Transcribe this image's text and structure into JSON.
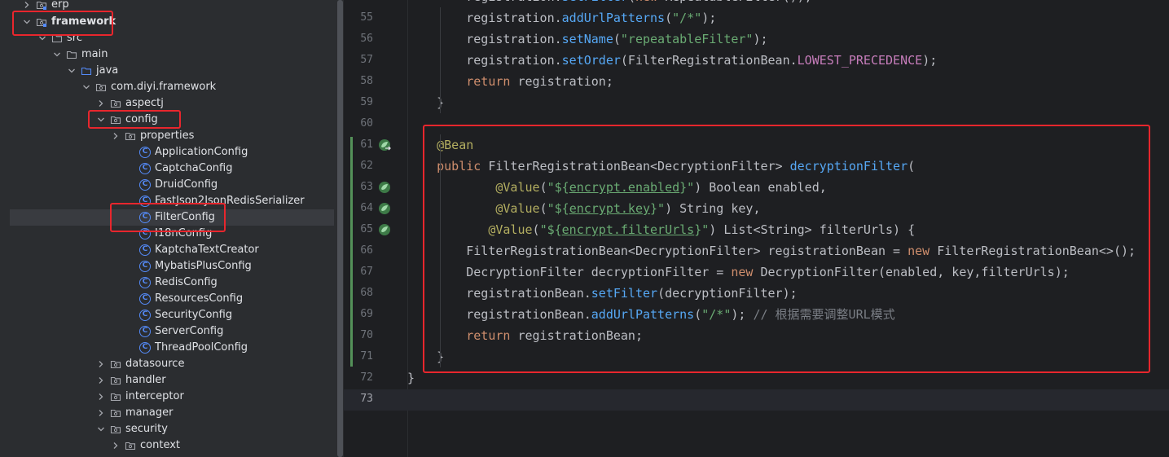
{
  "project_tree": {
    "items": [
      {
        "label": "erp",
        "type": "module",
        "expanded": false
      },
      {
        "label": "framework",
        "type": "module",
        "expanded": true
      },
      {
        "label": "src",
        "type": "folder",
        "expanded": true
      },
      {
        "label": "main",
        "type": "folder",
        "expanded": true
      },
      {
        "label": "java",
        "type": "source-folder",
        "expanded": true
      },
      {
        "label": "com.diyi.framework",
        "type": "package",
        "expanded": true
      },
      {
        "label": "aspectj",
        "type": "package",
        "expanded": false
      },
      {
        "label": "config",
        "type": "package",
        "expanded": true
      },
      {
        "label": "properties",
        "type": "package",
        "expanded": false
      },
      {
        "label": "ApplicationConfig",
        "type": "class"
      },
      {
        "label": "CaptchaConfig",
        "type": "class"
      },
      {
        "label": "DruidConfig",
        "type": "class"
      },
      {
        "label": "FastJson2JsonRedisSerializer",
        "type": "class"
      },
      {
        "label": "FilterConfig",
        "type": "class",
        "selected": true
      },
      {
        "label": "I18nConfig",
        "type": "class"
      },
      {
        "label": "KaptchaTextCreator",
        "type": "class"
      },
      {
        "label": "MybatisPlusConfig",
        "type": "class"
      },
      {
        "label": "RedisConfig",
        "type": "class"
      },
      {
        "label": "ResourcesConfig",
        "type": "class"
      },
      {
        "label": "SecurityConfig",
        "type": "class"
      },
      {
        "label": "ServerConfig",
        "type": "class"
      },
      {
        "label": "ThreadPoolConfig",
        "type": "class"
      },
      {
        "label": "datasource",
        "type": "package",
        "expanded": false
      },
      {
        "label": "handler",
        "type": "package",
        "expanded": false
      },
      {
        "label": "interceptor",
        "type": "package",
        "expanded": false
      },
      {
        "label": "manager",
        "type": "package",
        "expanded": false
      },
      {
        "label": "security",
        "type": "package",
        "expanded": true
      },
      {
        "label": "context",
        "type": "package",
        "expanded": false
      }
    ]
  },
  "editor": {
    "line_numbers": [
      "55",
      "56",
      "57",
      "58",
      "59",
      "60",
      "61",
      "62",
      "63",
      "64",
      "65",
      "66",
      "67",
      "68",
      "69",
      "70",
      "71",
      "72",
      "73"
    ],
    "current_line": "73",
    "lines": [
      [
        [
          "plain",
          "        registration."
        ],
        [
          "mth",
          "addUrlPatterns"
        ],
        [
          "plain",
          "("
        ],
        [
          "str",
          "\"/*\""
        ],
        [
          "plain",
          ");"
        ]
      ],
      [
        [
          "plain",
          "        registration."
        ],
        [
          "mth",
          "setName"
        ],
        [
          "plain",
          "("
        ],
        [
          "str",
          "\"repeatableFilter\""
        ],
        [
          "plain",
          ");"
        ]
      ],
      [
        [
          "plain",
          "        registration."
        ],
        [
          "mth",
          "setOrder"
        ],
        [
          "plain",
          "(FilterRegistrationBean."
        ],
        [
          "fld",
          "LOWEST_PRECEDENCE"
        ],
        [
          "plain",
          ");"
        ]
      ],
      [
        [
          "kw",
          "        return "
        ],
        [
          "plain",
          "registration;"
        ]
      ],
      [
        [
          "plain",
          "    }"
        ]
      ],
      [
        [
          "plain",
          ""
        ]
      ],
      [
        [
          "ann",
          "    @Bean"
        ]
      ],
      [
        [
          "kw",
          "    public "
        ],
        [
          "plain",
          "FilterRegistrationBean<DecryptionFilter> "
        ],
        [
          "mth",
          "decryptionFilter"
        ],
        [
          "plain",
          "("
        ]
      ],
      [
        [
          "ann",
          "            @Value"
        ],
        [
          "plain",
          "("
        ],
        [
          "str",
          "\"${"
        ],
        [
          "str",
          "encrypt.enabled"
        ],
        [
          "str",
          "}\""
        ],
        [
          "plain",
          ") Boolean enabled,"
        ]
      ],
      [
        [
          "ann",
          "            @Value"
        ],
        [
          "plain",
          "("
        ],
        [
          "str",
          "\"${"
        ],
        [
          "str",
          "encrypt.key"
        ],
        [
          "str",
          "}\""
        ],
        [
          "plain",
          ") String key,"
        ]
      ],
      [
        [
          "ann",
          "           @Value"
        ],
        [
          "plain",
          "("
        ],
        [
          "str",
          "\"${"
        ],
        [
          "str",
          "encrypt.filterUrls"
        ],
        [
          "str",
          "}\""
        ],
        [
          "plain",
          ") List<String> filterUrls) {"
        ]
      ],
      [
        [
          "plain",
          "        FilterRegistrationBean<DecryptionFilter> registrationBean = "
        ],
        [
          "kw",
          "new "
        ],
        [
          "plain",
          "FilterRegistrationBean<>();"
        ]
      ],
      [
        [
          "plain",
          "        DecryptionFilter decryptionFilter = "
        ],
        [
          "kw",
          "new "
        ],
        [
          "plain",
          "DecryptionFilter(enabled, key,filterUrls);"
        ]
      ],
      [
        [
          "plain",
          "        registrationBean."
        ],
        [
          "mth",
          "setFilter"
        ],
        [
          "plain",
          "(decryptionFilter);"
        ]
      ],
      [
        [
          "plain",
          "        registrationBean."
        ],
        [
          "mth",
          "addUrlPatterns"
        ],
        [
          "plain",
          "("
        ],
        [
          "str",
          "\"/*\""
        ],
        [
          "plain",
          ");"
        ],
        [
          "cmt",
          " // 根据需要调整URL模式"
        ]
      ],
      [
        [
          "kw",
          "        return "
        ],
        [
          "plain",
          "registrationBean;"
        ]
      ],
      [
        [
          "plain",
          "    }"
        ]
      ],
      [
        [
          "plain",
          "}"
        ]
      ],
      [
        [
          "plain",
          ""
        ]
      ]
    ],
    "top_partial_line": [
      [
        "plain",
        "        registration."
      ],
      [
        "mth",
        "setFilter"
      ],
      [
        "plain",
        "("
      ],
      [
        "kw",
        "new "
      ],
      [
        "plain",
        "RepeatableFilter());"
      ]
    ]
  },
  "colors": {
    "background": "#1e1f22",
    "sidebar": "#2b2d30",
    "keyword": "#cf8e6d",
    "annotation": "#b3ae60",
    "string": "#6aab73",
    "method": "#56a8f5",
    "constant": "#c77dbb",
    "highlight_box": "#e8262d"
  }
}
